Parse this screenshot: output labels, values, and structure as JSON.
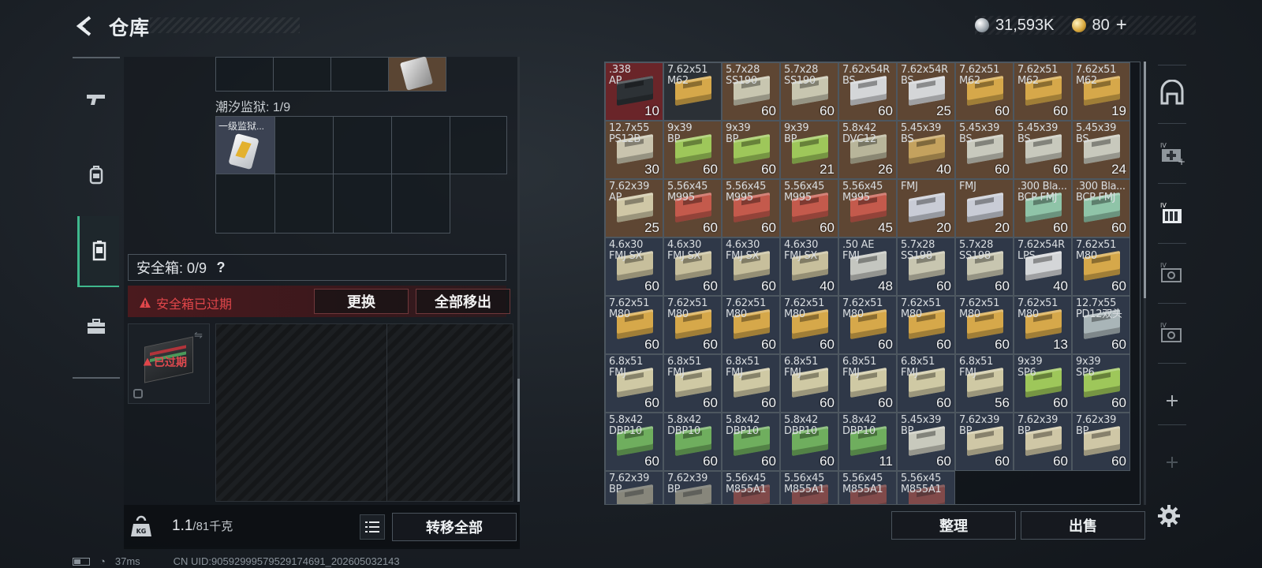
{
  "header": {
    "title": "仓库",
    "currency": [
      {
        "icon": "silver-coin-icon",
        "value": "31,593K"
      },
      {
        "icon": "gold-coin-icon",
        "value": "80"
      }
    ],
    "add_symbol": "+"
  },
  "rail": {
    "items": [
      {
        "name": "weapons",
        "icon": "pistol-icon"
      },
      {
        "name": "equipment",
        "icon": "backpack-icon"
      },
      {
        "name": "containers",
        "icon": "case-icon",
        "active": true
      },
      {
        "name": "toolbox",
        "icon": "toolbox-icon"
      }
    ]
  },
  "container": {
    "prison_label": "潮汐监狱: 1/9",
    "item_label": "一级监狱...",
    "safe_box_label": "安全箱: 0/9",
    "help": "?",
    "warning": "安全箱已过期",
    "replace_button": "更换",
    "remove_all_button": "全部移出",
    "expired_tag": "已过期"
  },
  "bottom_left": {
    "weight": "1.1",
    "weight_max": "/81千克",
    "weight_unit_icon": "KG",
    "transfer_all": "转移全部"
  },
  "inventory": {
    "cells": [
      {
        "cal": ".338\nAP",
        "qty": "10",
        "color": "#2d3236",
        "bg": "#6a2529"
      },
      {
        "cal": "7.62x51\nM62",
        "qty": "",
        "color": "#d6a84a",
        "bg": "#2b3036"
      },
      {
        "cal": "5.7x28\nSS190",
        "qty": "60",
        "color": "#c8c6b0",
        "bg": "#5e4633"
      },
      {
        "cal": "5.7x28\nSS190",
        "qty": "60",
        "color": "#c8c6b0",
        "bg": "#5e4633"
      },
      {
        "cal": "7.62x54R\nBS",
        "qty": "60",
        "color": "#d4d6d8",
        "bg": "#5e4633"
      },
      {
        "cal": "7.62x54R\nBS",
        "qty": "25",
        "color": "#d4d6d8",
        "bg": "#5e4633"
      },
      {
        "cal": "7.62x51\nM62",
        "qty": "60",
        "color": "#d6a84a",
        "bg": "#5e4633"
      },
      {
        "cal": "7.62x51\nM62",
        "qty": "60",
        "color": "#d6a84a",
        "bg": "#5e4633"
      },
      {
        "cal": "7.62x51\nM62",
        "qty": "19",
        "color": "#d6a84a",
        "bg": "#5e4633"
      },
      {
        "cal": "12.7x55\nPS12B",
        "qty": "30",
        "color": "#c9c4ae",
        "bg": "#5e4633"
      },
      {
        "cal": "9x39\nBP",
        "qty": "60",
        "color": "#9ec75a",
        "bg": "#5e4633"
      },
      {
        "cal": "9x39\nBP",
        "qty": "60",
        "color": "#9ec75a",
        "bg": "#5e4633"
      },
      {
        "cal": "9x39\nBP",
        "qty": "21",
        "color": "#9ec75a",
        "bg": "#5e4633"
      },
      {
        "cal": "5.8x42\nDVC12",
        "qty": "26",
        "color": "#b8b59a",
        "bg": "#5e4633"
      },
      {
        "cal": "5.45x39\nBS",
        "qty": "40",
        "color": "#c4a25e",
        "bg": "#5e4633"
      },
      {
        "cal": "5.45x39\nBS",
        "qty": "60",
        "color": "#c8c9bd",
        "bg": "#5e4633"
      },
      {
        "cal": "5.45x39\nBS",
        "qty": "60",
        "color": "#c8c9bd",
        "bg": "#5e4633"
      },
      {
        "cal": "5.45x39\nBS",
        "qty": "24",
        "color": "#c8c9bd",
        "bg": "#5e4633"
      },
      {
        "cal": "7.62x39\nAP",
        "qty": "25",
        "color": "#cfc7a6",
        "bg": "#5e4633"
      },
      {
        "cal": "5.56x45\nM995",
        "qty": "60",
        "color": "#c45a4c",
        "bg": "#5e4633"
      },
      {
        "cal": "5.56x45\nM995",
        "qty": "60",
        "color": "#c45a4c",
        "bg": "#5e4633"
      },
      {
        "cal": "5.56x45\nM995",
        "qty": "60",
        "color": "#c45a4c",
        "bg": "#5e4633"
      },
      {
        "cal": "5.56x45\nM995",
        "qty": "45",
        "color": "#c45a4c",
        "bg": "#5e4633"
      },
      {
        "cal": "FMJ",
        "qty": "20",
        "color": "#c9ccd6",
        "bg": "#5e4633"
      },
      {
        "cal": "FMJ",
        "qty": "20",
        "color": "#c9ccd6",
        "bg": "#5e4633"
      },
      {
        "cal": ".300 Bla...\nBCP FMJ",
        "qty": "60",
        "color": "#8fc4a8",
        "bg": "#5e4633"
      },
      {
        "cal": ".300 Bla...\nBCP FMJ",
        "qty": "60",
        "color": "#8fc4a8",
        "bg": "#5e4633"
      },
      {
        "cal": "4.6x30\nFMJ SX",
        "qty": "60",
        "color": "#c7bf9c",
        "bg": "#2f3848"
      },
      {
        "cal": "4.6x30\nFMJ SX",
        "qty": "60",
        "color": "#c7bf9c",
        "bg": "#2f3848"
      },
      {
        "cal": "4.6x30\nFMJ SX",
        "qty": "60",
        "color": "#c7bf9c",
        "bg": "#2f3848"
      },
      {
        "cal": "4.6x30\nFMJ SX",
        "qty": "40",
        "color": "#c7bf9c",
        "bg": "#2f3848"
      },
      {
        "cal": ".50 AE\nFMJ",
        "qty": "48",
        "color": "#c4c6c0",
        "bg": "#2f3848"
      },
      {
        "cal": "5.7x28\nSS198",
        "qty": "60",
        "color": "#c8c6b0",
        "bg": "#2f3848"
      },
      {
        "cal": "5.7x28\nSS198",
        "qty": "60",
        "color": "#c8c6b0",
        "bg": "#2f3848"
      },
      {
        "cal": "7.62x54R\nLPS",
        "qty": "40",
        "color": "#d4d6d8",
        "bg": "#2f3848"
      },
      {
        "cal": "7.62x51\nM80",
        "qty": "60",
        "color": "#d6a84a",
        "bg": "#2f3848"
      },
      {
        "cal": "7.62x51\nM80",
        "qty": "60",
        "color": "#d6a84a",
        "bg": "#2f3848"
      },
      {
        "cal": "7.62x51\nM80",
        "qty": "60",
        "color": "#d6a84a",
        "bg": "#2f3848"
      },
      {
        "cal": "7.62x51\nM80",
        "qty": "60",
        "color": "#d6a84a",
        "bg": "#2f3848"
      },
      {
        "cal": "7.62x51\nM80",
        "qty": "60",
        "color": "#d6a84a",
        "bg": "#2f3848"
      },
      {
        "cal": "7.62x51\nM80",
        "qty": "60",
        "color": "#d6a84a",
        "bg": "#2f3848"
      },
      {
        "cal": "7.62x51\nM80",
        "qty": "60",
        "color": "#d6a84a",
        "bg": "#2f3848"
      },
      {
        "cal": "7.62x51\nM80",
        "qty": "60",
        "color": "#d6a84a",
        "bg": "#2f3848"
      },
      {
        "cal": "7.62x51\nM80",
        "qty": "13",
        "color": "#d6a84a",
        "bg": "#2f3848"
      },
      {
        "cal": "12.7x55\nPD12双头",
        "qty": "60",
        "color": "#a9b5b8",
        "bg": "#2f3848"
      },
      {
        "cal": "6.8x51\nFMJ",
        "qty": "60",
        "color": "#cfc9a4",
        "bg": "#2f3848"
      },
      {
        "cal": "6.8x51\nFMJ",
        "qty": "60",
        "color": "#cfc9a4",
        "bg": "#2f3848"
      },
      {
        "cal": "6.8x51\nFMJ",
        "qty": "60",
        "color": "#cfc9a4",
        "bg": "#2f3848"
      },
      {
        "cal": "6.8x51\nFMJ",
        "qty": "60",
        "color": "#cfc9a4",
        "bg": "#2f3848"
      },
      {
        "cal": "6.8x51\nFMJ",
        "qty": "60",
        "color": "#cfc9a4",
        "bg": "#2f3848"
      },
      {
        "cal": "6.8x51\nFMJ",
        "qty": "60",
        "color": "#cfc9a4",
        "bg": "#2f3848"
      },
      {
        "cal": "6.8x51\nFMJ",
        "qty": "56",
        "color": "#cfc9a4",
        "bg": "#2f3848"
      },
      {
        "cal": "9x39\nSP6",
        "qty": "60",
        "color": "#9ec75a",
        "bg": "#2f3848"
      },
      {
        "cal": "9x39\nSP6",
        "qty": "60",
        "color": "#9ec75a",
        "bg": "#2f3848"
      },
      {
        "cal": "5.8x42\nDBP10",
        "qty": "60",
        "color": "#6fae5e",
        "bg": "#2f3848"
      },
      {
        "cal": "5.8x42\nDBP10",
        "qty": "60",
        "color": "#6fae5e",
        "bg": "#2f3848"
      },
      {
        "cal": "5.8x42\nDBP10",
        "qty": "60",
        "color": "#6fae5e",
        "bg": "#2f3848"
      },
      {
        "cal": "5.8x42\nDBP10",
        "qty": "60",
        "color": "#6fae5e",
        "bg": "#2f3848"
      },
      {
        "cal": "5.8x42\nDBP10",
        "qty": "11",
        "color": "#6fae5e",
        "bg": "#2f3848"
      },
      {
        "cal": "5.45x39\nBP",
        "qty": "60",
        "color": "#c8c9bd",
        "bg": "#2f3848"
      },
      {
        "cal": "7.62x39\nBP",
        "qty": "60",
        "color": "#cfc7a6",
        "bg": "#2f3848"
      },
      {
        "cal": "7.62x39\nBP",
        "qty": "60",
        "color": "#cfc7a6",
        "bg": "#2f3848"
      },
      {
        "cal": "7.62x39\nBP",
        "qty": "60",
        "color": "#cfc7a6",
        "bg": "#2f3848"
      },
      {
        "cal": "7.62x39\nBP",
        "qty": "",
        "color": "#cfc7a6",
        "bg": "#2f3848"
      },
      {
        "cal": "7.62x39\nBP",
        "qty": "",
        "color": "#cfc7a6",
        "bg": "#2f3848"
      },
      {
        "cal": "5.56x45\nM855A1",
        "qty": "",
        "color": "#c45a4c",
        "bg": "#2f3848"
      },
      {
        "cal": "5.56x45\nM855A1",
        "qty": "",
        "color": "#c45a4c",
        "bg": "#2f3848"
      },
      {
        "cal": "5.56x45\nM855A1",
        "qty": "",
        "color": "#c45a4c",
        "bg": "#2f3848"
      },
      {
        "cal": "5.56x45\nM855A1",
        "qty": "",
        "color": "#c45a4c",
        "bg": "#2f3848"
      }
    ]
  },
  "side_tools": {
    "items": [
      {
        "name": "storage-home",
        "icon": "bunker-icon"
      },
      {
        "name": "medical",
        "icon": "medkit-icon"
      },
      {
        "name": "ammo-box",
        "icon": "ammo-box-icon"
      },
      {
        "name": "gear",
        "icon": "gear-case-icon"
      },
      {
        "name": "gear2",
        "icon": "gear-case-icon"
      },
      {
        "name": "add",
        "icon": "plus-icon"
      },
      {
        "name": "add-disabled",
        "icon": "plus-icon"
      }
    ]
  },
  "bottom_right": {
    "sort": "整理",
    "sell": "出售"
  },
  "status": {
    "ping": "37ms",
    "uid": "CN UID:9059299957952917469​1_202605032143"
  }
}
